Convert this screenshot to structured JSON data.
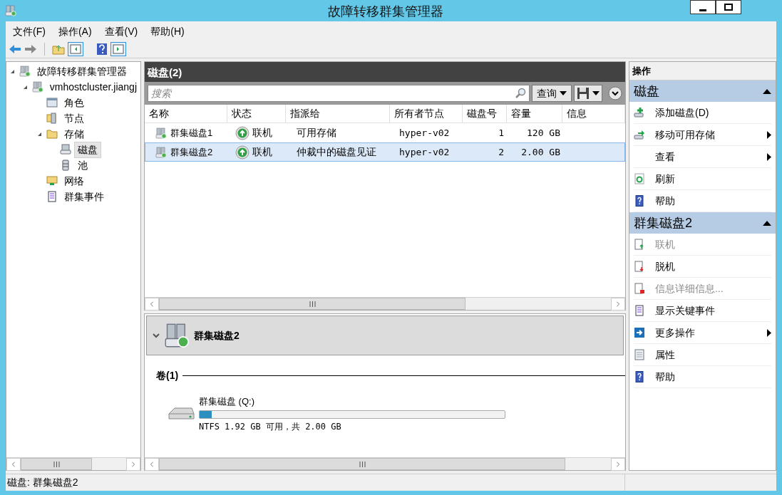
{
  "window": {
    "title": "故障转移群集管理器"
  },
  "menu": [
    "文件(F)",
    "操作(A)",
    "查看(V)",
    "帮助(H)"
  ],
  "tree": [
    {
      "label": "故障转移群集管理器",
      "selected": false,
      "expanded": true,
      "children": [
        {
          "label": "vmhostcluster.jiangj",
          "selected": false,
          "expanded": true,
          "children": [
            {
              "label": "角色",
              "selected": false
            },
            {
              "label": "节点",
              "selected": false
            },
            {
              "label": "存储",
              "selected": false,
              "expanded": true,
              "children": [
                {
                  "label": "磁盘",
                  "selected": true
                },
                {
                  "label": "池",
                  "selected": false
                }
              ]
            },
            {
              "label": "网络",
              "selected": false
            },
            {
              "label": "群集事件",
              "selected": false
            }
          ]
        }
      ]
    }
  ],
  "disks_panel": {
    "title": "磁盘(2)",
    "search": {
      "placeholder": "搜索"
    },
    "query_button": "查询",
    "columns": [
      "名称",
      "状态",
      "指派给",
      "所有者节点",
      "磁盘号",
      "容量",
      "信息"
    ],
    "rows": [
      {
        "name": "群集磁盘1",
        "status": "联机",
        "assigned": "可用存储",
        "owner": "hyper-v02",
        "number": "1",
        "capacity": "120 GB",
        "selected": false
      },
      {
        "name": "群集磁盘2",
        "status": "联机",
        "assigned": "仲裁中的磁盘见证",
        "owner": "hyper-v02",
        "number": "2",
        "capacity": "2.00 GB",
        "selected": true
      }
    ]
  },
  "details": {
    "title": "群集磁盘2",
    "section": "卷(1)",
    "volume": {
      "name": "群集磁盘 (Q:)",
      "level": 0.04,
      "info": "NTFS 1.92 GB 可用，共 2.00 GB"
    }
  },
  "actions": {
    "header": "操作",
    "groups": [
      {
        "title": "磁盘",
        "expanded": true,
        "items": [
          {
            "label": "添加磁盘(D)",
            "disabled": false,
            "submenu": false
          },
          {
            "label": "移动可用存储",
            "disabled": false,
            "submenu": true
          },
          {
            "label": "查看",
            "disabled": false,
            "submenu": true
          },
          {
            "label": "刷新",
            "disabled": false,
            "submenu": false
          },
          {
            "label": "帮助",
            "disabled": false,
            "submenu": false
          }
        ]
      },
      {
        "title": "群集磁盘2",
        "expanded": true,
        "items": [
          {
            "label": "联机",
            "disabled": true,
            "submenu": false
          },
          {
            "label": "脱机",
            "disabled": false,
            "submenu": false
          },
          {
            "label": "信息详细信息...",
            "disabled": true,
            "submenu": false
          },
          {
            "label": "显示关键事件",
            "disabled": false,
            "submenu": false
          },
          {
            "label": "更多操作",
            "disabled": false,
            "submenu": true
          },
          {
            "label": "属性",
            "disabled": false,
            "submenu": false
          },
          {
            "label": "帮助",
            "disabled": false,
            "submenu": false
          }
        ]
      }
    ]
  },
  "status_bar": "磁盘: 群集磁盘2"
}
